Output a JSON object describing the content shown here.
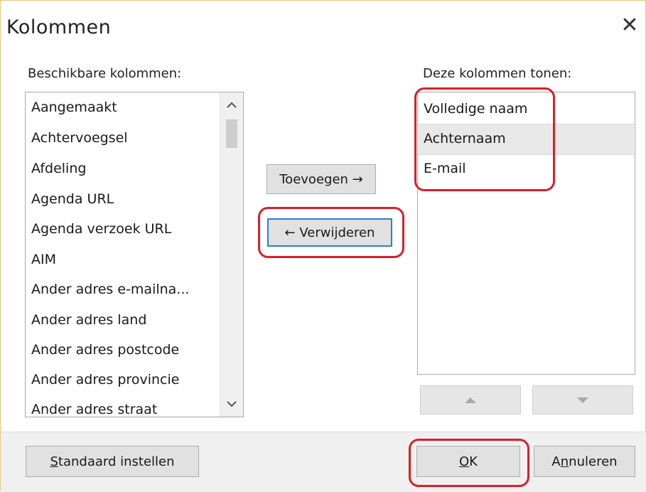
{
  "dialog": {
    "title": "Kolommen",
    "close_glyph": "✕"
  },
  "available": {
    "label": "Beschikbare kolommen:",
    "items": [
      "Aangemaakt",
      "Achtervoegsel",
      "Afdeling",
      "Agenda URL",
      "Agenda verzoek URL",
      "AIM",
      "Ander adres e-mailna...",
      "Ander adres land",
      "Ander adres postcode",
      "Ander adres provincie",
      "Ander adres straat"
    ],
    "scroll_up_icon": "chevron-up-icon",
    "scroll_down_icon": "chevron-down-icon"
  },
  "buttons": {
    "add_label": "Toevoegen →",
    "remove_label": "← Verwijderen",
    "move_up_icon": "triangle-up-icon",
    "move_down_icon": "triangle-down-icon"
  },
  "shown": {
    "label": "Deze kolommen tonen:",
    "items": [
      "Volledige naam",
      "Achternaam",
      "E-mail"
    ],
    "selected_index": 1
  },
  "footer": {
    "defaults_label_prefix": "S",
    "defaults_label_rest": "tandaard instellen",
    "ok_label_prefix": "O",
    "ok_label_rest": "K",
    "cancel_label_prefix": "A",
    "cancel_label_mid": "n",
    "cancel_label_rest": "nuleren"
  },
  "colors": {
    "highlight": "#d81f2a",
    "focus_border": "#2a7fd4"
  }
}
